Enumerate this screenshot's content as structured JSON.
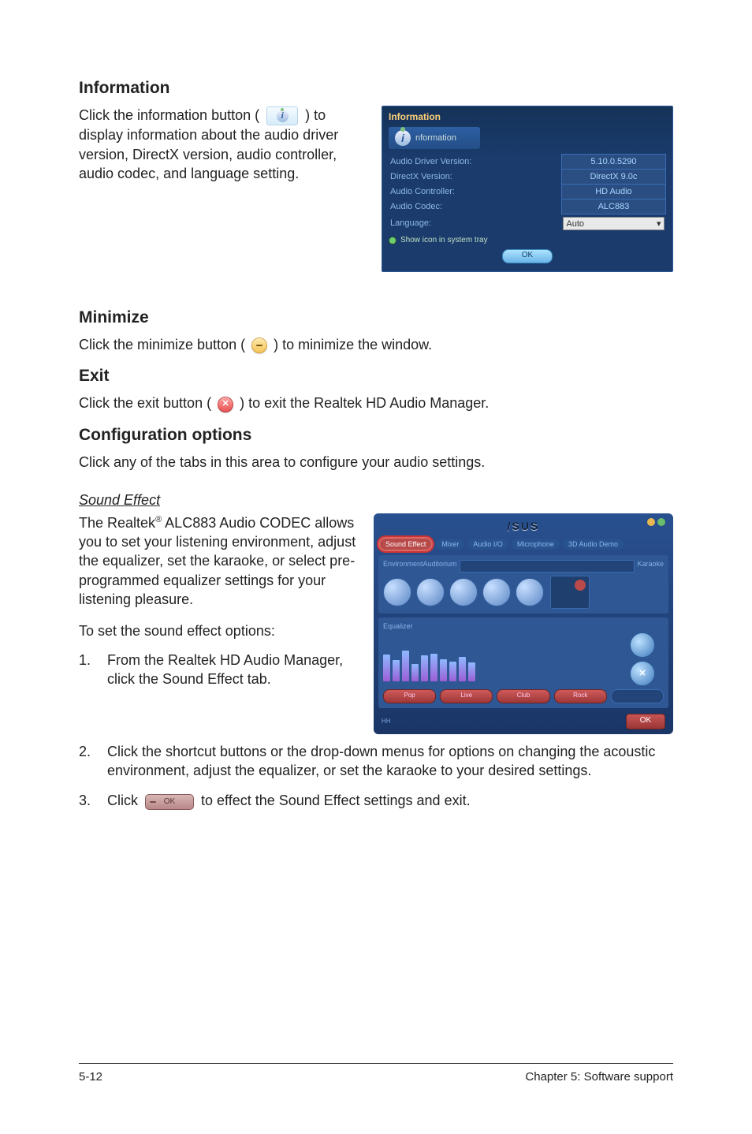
{
  "sections": {
    "information": {
      "heading": "Information",
      "paragraph_parts": {
        "pre": "Click the information button ( ",
        "post": " ) to display information about the audio driver version, DirectX version, audio controller, audio codec, and language setting."
      },
      "shot": {
        "title": "Information",
        "badge": "nformation",
        "rows": [
          {
            "k": "Audio Driver Version:",
            "v": "5.10.0.5290"
          },
          {
            "k": "DirectX Version:",
            "v": "DirectX 9.0c"
          },
          {
            "k": "Audio Controller:",
            "v": "HD Audio"
          },
          {
            "k": "Audio Codec:",
            "v": "ALC883"
          }
        ],
        "language_label": "Language:",
        "language_value": "Auto",
        "tray": "Show icon in system tray",
        "ok": "OK"
      }
    },
    "minimize": {
      "heading": "Minimize",
      "parts": {
        "pre": "Click the minimize button (",
        "post": ") to minimize the window."
      }
    },
    "exit": {
      "heading": "Exit",
      "parts": {
        "pre": "Click the exit button (",
        "post": ") to exit the Realtek HD Audio Manager."
      },
      "exit_glyph": "✕"
    },
    "config": {
      "heading": "Configuration options",
      "paragraph": "Click any of the tabs in this area to configure your audio settings."
    },
    "sound_effect": {
      "subheading": "Sound Effect",
      "para_parts": {
        "a": "The Realtek",
        "sup": "®",
        "b": " ALC883 Audio CODEC allows you to set your listening environment, adjust the equalizer, set the karaoke, or select pre-programmed equalizer settings for your listening pleasure."
      },
      "lead": "To set the sound effect options:",
      "steps": {
        "1": "From the Realtek HD Audio Manager, click the Sound Effect tab.",
        "2": "Click the shortcut buttons or the drop-down menus for options on changing the acoustic environment, adjust the equalizer, or set the karaoke to your desired settings.",
        "3_pre": "Click ",
        "3_ok_label": "OK",
        "3_post": " to effect the Sound Effect settings and exit."
      },
      "shot": {
        "logo": "/SUS",
        "tabs": [
          "Sound Effect",
          "Mixer",
          "Audio I/O",
          "Microphone",
          "3D Audio Demo"
        ],
        "panel_env_left": "Environment",
        "panel_env_mid": "Auditorium",
        "panel_env_right": "Karaoke",
        "eq_label": "Equalizer",
        "presets": [
          "Pop",
          "Live",
          "Club",
          "Rock"
        ],
        "preset_sel": "",
        "footer_left": "HH",
        "ok": "OK"
      }
    }
  },
  "footer": {
    "left": "5-12",
    "right": "Chapter 5: Software support"
  }
}
